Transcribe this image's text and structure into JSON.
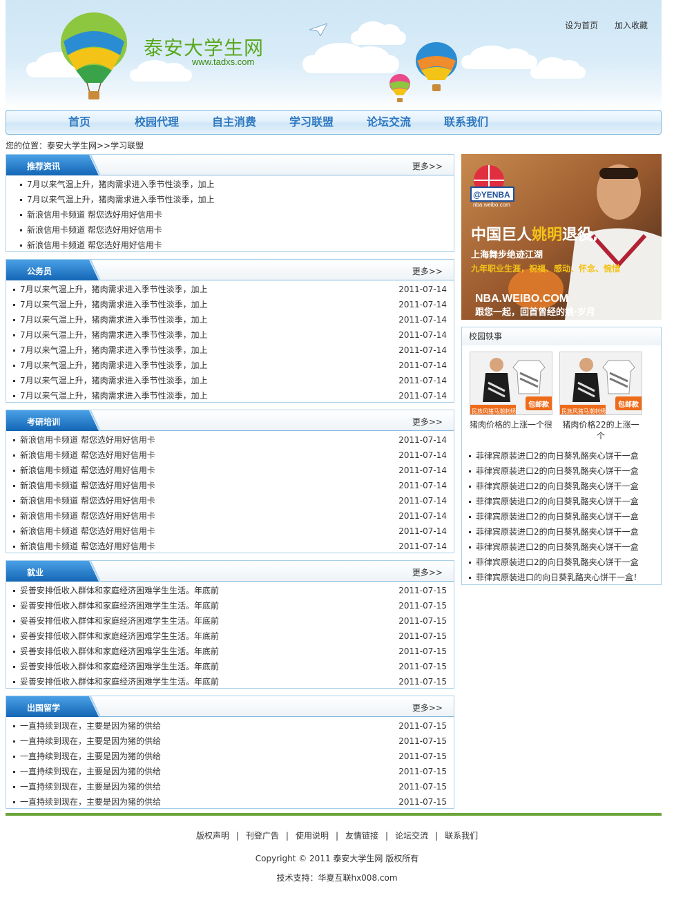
{
  "header": {
    "site_name": "泰安大学生网",
    "site_url": "www.tadxs.com",
    "set_home": "设为首页",
    "add_favorite": "加入收藏"
  },
  "nav": {
    "items": [
      "首页",
      "校园代理",
      "自主消费",
      "学习联盟",
      "论坛交流",
      "联系我们"
    ]
  },
  "breadcrumb": "您的位置：泰安大学生网>>学习联盟",
  "more_label": "更多>>",
  "sections": [
    {
      "title": "推荐资讯",
      "items": [
        {
          "text": "7月以来气温上升，猪肉需求进入季节性淡季，加上"
        },
        {
          "text": "7月以来气温上升，猪肉需求进入季节性淡季，加上"
        },
        {
          "text": "新浪信用卡频道 帮您选好用好信用卡"
        },
        {
          "text": "新浪信用卡频道 帮您选好用好信用卡"
        },
        {
          "text": "新浪信用卡频道 帮您选好用好信用卡"
        }
      ]
    },
    {
      "title": "公务员",
      "items": [
        {
          "text": "7月以来气温上升，猪肉需求进入季节性淡季，加上",
          "date": "2011-07-14"
        },
        {
          "text": "7月以来气温上升，猪肉需求进入季节性淡季，加上",
          "date": "2011-07-14"
        },
        {
          "text": "7月以来气温上升，猪肉需求进入季节性淡季，加上",
          "date": "2011-07-14"
        },
        {
          "text": "7月以来气温上升，猪肉需求进入季节性淡季，加上",
          "date": "2011-07-14"
        },
        {
          "text": "7月以来气温上升，猪肉需求进入季节性淡季，加上",
          "date": "2011-07-14"
        },
        {
          "text": "7月以来气温上升，猪肉需求进入季节性淡季，加上",
          "date": "2011-07-14"
        },
        {
          "text": "7月以来气温上升，猪肉需求进入季节性淡季，加上",
          "date": "2011-07-14"
        },
        {
          "text": "7月以来气温上升，猪肉需求进入季节性淡季，加上",
          "date": "2011-07-14"
        }
      ]
    },
    {
      "title": "考研培训",
      "items": [
        {
          "text": "新浪信用卡频道 帮您选好用好信用卡",
          "date": "2011-07-14"
        },
        {
          "text": "新浪信用卡频道 帮您选好用好信用卡",
          "date": "2011-07-14"
        },
        {
          "text": "新浪信用卡频道 帮您选好用好信用卡",
          "date": "2011-07-14"
        },
        {
          "text": "新浪信用卡频道 帮您选好用好信用卡",
          "date": "2011-07-14"
        },
        {
          "text": "新浪信用卡频道 帮您选好用好信用卡",
          "date": "2011-07-14"
        },
        {
          "text": "新浪信用卡频道 帮您选好用好信用卡",
          "date": "2011-07-14"
        },
        {
          "text": "新浪信用卡频道 帮您选好用好信用卡",
          "date": "2011-07-14"
        },
        {
          "text": "新浪信用卡频道 帮您选好用好信用卡",
          "date": "2011-07-14"
        }
      ]
    },
    {
      "title": "就业",
      "items": [
        {
          "text": "妥善安排低收入群体和家庭经济困难学生生活。年底前",
          "date": "2011-07-15"
        },
        {
          "text": "妥善安排低收入群体和家庭经济困难学生生活。年底前",
          "date": "2011-07-15"
        },
        {
          "text": "妥善安排低收入群体和家庭经济困难学生生活。年底前",
          "date": "2011-07-15"
        },
        {
          "text": "妥善安排低收入群体和家庭经济困难学生生活。年底前",
          "date": "2011-07-15"
        },
        {
          "text": "妥善安排低收入群体和家庭经济困难学生生活。年底前",
          "date": "2011-07-15"
        },
        {
          "text": "妥善安排低收入群体和家庭经济困难学生生活。年底前",
          "date": "2011-07-15"
        },
        {
          "text": "妥善安排低收入群体和家庭经济困难学生生活。年底前",
          "date": "2011-07-15"
        }
      ]
    },
    {
      "title": "出国留学",
      "items": [
        {
          "text": "一直持续到现在，主要是因为猪的供给",
          "date": "2011-07-15"
        },
        {
          "text": "一直持续到现在，主要是因为猪的供给",
          "date": "2011-07-15"
        },
        {
          "text": "一直持续到现在，主要是因为猪的供给",
          "date": "2011-07-15"
        },
        {
          "text": "一直持续到现在，主要是因为猪的供给",
          "date": "2011-07-15"
        },
        {
          "text": "一直持续到现在，主要是因为猪的供给",
          "date": "2011-07-15"
        },
        {
          "text": "一直持续到现在，主要是因为猪的供给",
          "date": "2011-07-15"
        }
      ]
    }
  ],
  "ad": {
    "brand": "@YENBA",
    "brand_sub": "nba.weibo.com",
    "headline_a": "中国巨人",
    "headline_name": "姚明",
    "headline_b": "退役,",
    "line2": "上海舞步绝迹江湖",
    "line3": "九年职业生涯，祝福、感动、怀念、惋惜",
    "line4": "NBA.WEIBO.COM",
    "line5": "跟您一起，回首曾经的姚·岁月"
  },
  "campus": {
    "title": "校园轶事",
    "thumb_badge_left": "民族风猪马潮刺绣",
    "thumb_badge_right": "包邮款",
    "thumbs": [
      {
        "caption": "猪肉价格的上涨一个很"
      },
      {
        "caption": "猪肉价格22的上涨一个"
      }
    ],
    "items": [
      "菲律宾原装进口2的向日葵乳酪夹心饼干一盒",
      "菲律宾原装进口2的向日葵乳酪夹心饼干一盒",
      "菲律宾原装进口2的向日葵乳酪夹心饼干一盒",
      "菲律宾原装进口2的向日葵乳酪夹心饼干一盒",
      "菲律宾原装进口2的向日葵乳酪夹心饼干一盒",
      "菲律宾原装进口2的向日葵乳酪夹心饼干一盒",
      "菲律宾原装进口2的向日葵乳酪夹心饼干一盒",
      "菲律宾原装进口2的向日葵乳酪夹心饼干一盒",
      "菲律宾原装进口的向日葵乳酪夹心饼干一盒！"
    ]
  },
  "footer": {
    "links": [
      "版权声明",
      "刊登广告",
      "使用说明",
      "友情链接",
      "论坛交流",
      "联系我们"
    ],
    "separator": "|",
    "copyright": "Copyright © 2011 泰安大学生网 版权所有",
    "support": "技术支持：华夏互联hx008.com"
  },
  "colors": {
    "nav_text": "#2e78c0",
    "tab_blue": "#1a74c4",
    "logo_green": "#5aa81e",
    "footer_line": "#6ba53a",
    "border": "#a9cfe8"
  }
}
